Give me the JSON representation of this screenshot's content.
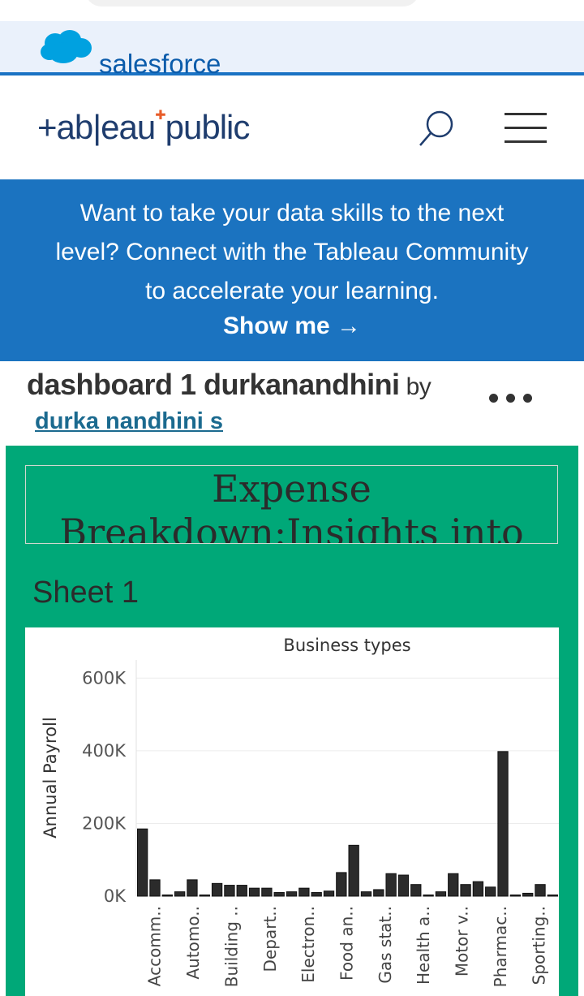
{
  "salesforce": {
    "wordmark": "salesforce"
  },
  "header": {
    "logo": "+ab|eau+public",
    "logo_text_a": "+ab|eau",
    "logo_text_b": "public",
    "search_icon": "search-icon",
    "menu_icon": "hamburger-menu-icon"
  },
  "banner": {
    "text": "Want to take your data skills to the next level? Connect with the Tableau Community to accelerate your learning.",
    "cta": "Show me →"
  },
  "viz": {
    "title": "dashboard 1 durkanandhini",
    "by": "by",
    "author": "durka nandhini s"
  },
  "dashboard": {
    "title_line1": "Expense",
    "title_line2": "Breakdown:Insights into",
    "sheet_title": "Sheet 1"
  },
  "colors": {
    "accent": "#00a878",
    "banner": "#1b73c0",
    "bar": "#2b2b2b"
  },
  "chart_data": {
    "type": "bar",
    "title": "Business types",
    "ylabel": "Annual Payroll",
    "ylim": [
      0,
      650000
    ],
    "yticks": [
      0,
      200000,
      400000,
      600000
    ],
    "ytick_labels": [
      "0K",
      "200K",
      "400K",
      "600K"
    ],
    "xtick_labels": [
      "Accomm..",
      "Automo..",
      "Building ..",
      "Depart..",
      "Electron..",
      "Food an..",
      "Gas stat..",
      "Health a..",
      "Motor v..",
      "Pharmac..",
      "Sporting.."
    ],
    "values": [
      185000,
      45000,
      3000,
      12000,
      45000,
      3000,
      35000,
      30000,
      30000,
      22000,
      22000,
      10000,
      12000,
      22000,
      10000,
      14000,
      65000,
      140000,
      12000,
      18000,
      62000,
      58000,
      32000,
      0,
      12000,
      62000,
      32000,
      40000,
      25000,
      398000,
      2000,
      8000,
      32000,
      3000
    ]
  }
}
